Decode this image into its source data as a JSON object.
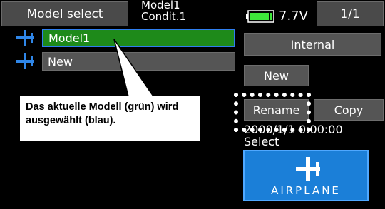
{
  "header": {
    "screen_title": "Model select",
    "model_name": "Model1",
    "condition": "Condit.1",
    "battery_voltage": "7.7V",
    "page_indicator": "1/1"
  },
  "model_list": [
    {
      "label": "Model1",
      "selected": true
    },
    {
      "label": "New",
      "selected": false
    }
  ],
  "buttons": {
    "internal": "Internal",
    "new": "New",
    "rename": "Rename",
    "copy": "Copy"
  },
  "info": {
    "datetime": "2000/1/1 0:00:00",
    "select_label": "Select"
  },
  "model_type": {
    "label": "AIRPLANE",
    "icon": "airplane-icon"
  },
  "annotation": {
    "line1": "Das aktuelle Modell (grün) wird",
    "line2": "ausgewählt (blau)."
  },
  "colors": {
    "selected_row": "#1e8a1a",
    "selection_border": "#2f7ef0",
    "model_type_button": "#1b7fd8",
    "icon_blue": "#2f86e8",
    "battery_green": "#3ee63a"
  }
}
